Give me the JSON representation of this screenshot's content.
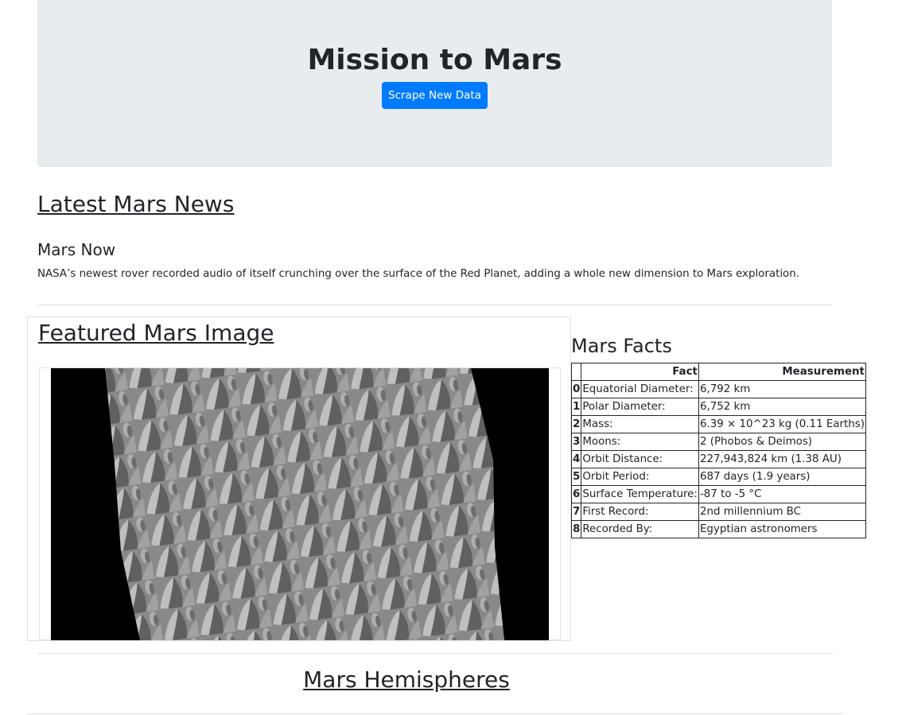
{
  "header": {
    "title": "Mission to Mars",
    "scrape_button": "Scrape New Data"
  },
  "news": {
    "heading": "Latest Mars News",
    "title": "Mars Now",
    "paragraph": "NASA’s newest rover recorded audio of itself crunching over the surface of the Red Planet, adding a whole new dimension to Mars exploration."
  },
  "featured": {
    "heading": "Featured Mars Image"
  },
  "facts": {
    "heading": "Mars Facts",
    "columns": [
      "",
      "Fact",
      "Measurement"
    ],
    "rows": [
      {
        "idx": "0",
        "fact": "Equatorial Diameter:",
        "value": "6,792 km"
      },
      {
        "idx": "1",
        "fact": "Polar Diameter:",
        "value": "6,752 km"
      },
      {
        "idx": "2",
        "fact": "Mass:",
        "value": "6.39 × 10^23 kg (0.11 Earths)"
      },
      {
        "idx": "3",
        "fact": "Moons:",
        "value": "2 (Phobos & Deimos)"
      },
      {
        "idx": "4",
        "fact": "Orbit Distance:",
        "value": "227,943,824 km (1.38 AU)"
      },
      {
        "idx": "5",
        "fact": "Orbit Period:",
        "value": "687 days (1.9 years)"
      },
      {
        "idx": "6",
        "fact": "Surface Temperature:",
        "value": "-87 to -5 °C"
      },
      {
        "idx": "7",
        "fact": "First Record:",
        "value": "2nd millennium BC"
      },
      {
        "idx": "8",
        "fact": "Recorded By:",
        "value": "Egyptian astronomers"
      }
    ]
  },
  "hemispheres": {
    "heading": "Mars Hemispheres"
  },
  "colors": {
    "jumbotron_bg": "#e9ecef",
    "button_bg": "#007bff"
  }
}
